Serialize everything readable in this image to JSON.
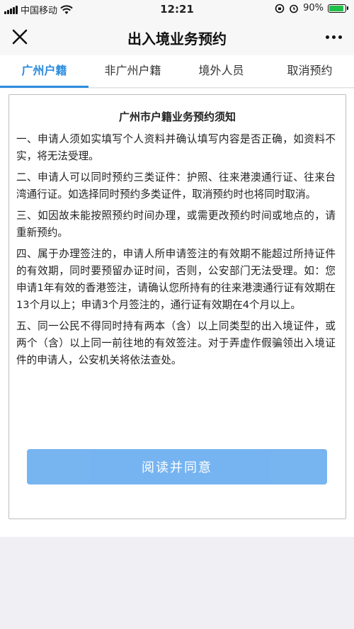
{
  "status_bar": {
    "carrier": "中国移动",
    "time": "12:21",
    "battery": "90%",
    "battery_level": 0.9
  },
  "nav": {
    "title": "出入境业务预约"
  },
  "tabs": [
    {
      "label": "广州户籍",
      "active": true
    },
    {
      "label": "非广州户籍",
      "active": false
    },
    {
      "label": "境外人员",
      "active": false
    },
    {
      "label": "取消预约",
      "active": false
    }
  ],
  "notice": {
    "title": "广州市户籍业务预约须知",
    "paragraphs": [
      "一、申请人须如实填写个人资料并确认填写内容是否正确，如资料不实，将无法受理。",
      "二、申请人可以同时预约三类证件：护照、往来港澳通行证、往来台湾通行证。如选择同时预约多类证件，取消预约时也将同时取消。",
      "三、如因故未能按照预约时间办理，或需更改预约时间或地点的，请重新预约。",
      "四、属于办理签注的，申请人所申请签注的有效期不能超过所持证件的有效期，同时要预留办证时间，否则，公安部门无法受理。如：您申请1年有效的香港签注，请确认您所持有的往来港澳通行证有效期在13个月以上；申请3个月签注的，通行证有效期在4个月以上。",
      "五、同一公民不得同时持有两本（含）以上同类型的出入境证件，或两个（含）以上同一前往地的有效签注。对于弄虚作假骗领出入境证件的申请人，公安机关将依法查处。"
    ],
    "agree_label": "阅读并同意"
  },
  "colors": {
    "accent": "#2b8cde",
    "button": "#5fa8ef",
    "battery": "#21c04a"
  }
}
